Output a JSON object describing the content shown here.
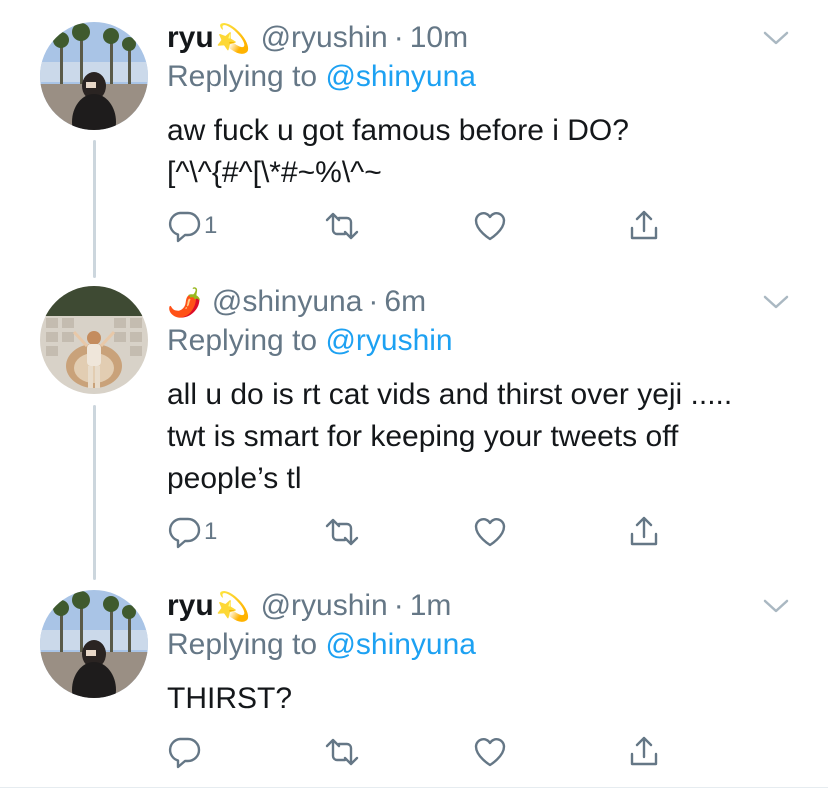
{
  "tweets": [
    {
      "name": "ryu",
      "name_emoji": "💫",
      "handle": "@ryushin",
      "separator": "·",
      "time": "10m",
      "replying_prefix": "Replying to",
      "replying_to": "@shinyuna",
      "lines": [
        "aw fuck u got famous before i DO?",
        "[^\\^{#^[\\*#~%\\^~"
      ],
      "reply_count": "1"
    },
    {
      "name": "",
      "name_emoji": "🌶️",
      "handle": "@shinyuna",
      "separator": "·",
      "time": "6m",
      "replying_prefix": "Replying to",
      "replying_to": "@ryushin",
      "lines": [
        "all u do is rt cat vids and thirst over yeji .....",
        "twt is smart for keeping your tweets off",
        "people’s tl"
      ],
      "reply_count": "1"
    },
    {
      "name": "ryu",
      "name_emoji": "💫",
      "handle": "@ryushin",
      "separator": "·",
      "time": "1m",
      "replying_prefix": "Replying to",
      "replying_to": "@shinyuna",
      "lines": [
        "THIRST?"
      ],
      "reply_count": ""
    }
  ],
  "icons": {
    "reply": "reply-icon",
    "retweet": "retweet-icon",
    "like": "heart-icon",
    "share": "share-icon",
    "more": "chevron-down-icon"
  },
  "colors": {
    "link": "#1da1f2",
    "secondary": "#657786",
    "thread_line": "#ccd6dd"
  }
}
